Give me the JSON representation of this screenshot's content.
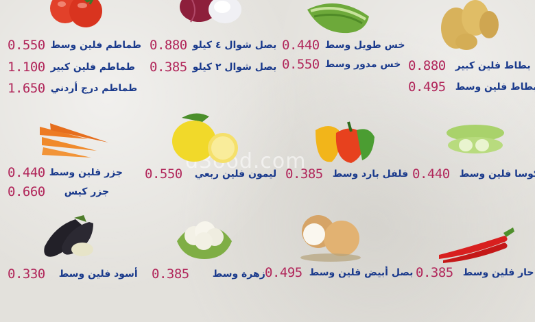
{
  "watermark": "d3ood.com",
  "items": {
    "tomato": {
      "rows": [
        {
          "name": "طماطم فلين وسط",
          "price": "0.550"
        },
        {
          "name": "طماطم فلين كبير",
          "price": "1.100"
        },
        {
          "name": "طماطم درج أردني",
          "price": "1.650"
        }
      ]
    },
    "onion": {
      "rows": [
        {
          "name": "بصل شوال ٤ كيلو",
          "price": "0.880"
        },
        {
          "name": "بصل شوال ٢ كيلو",
          "price": "0.385"
        }
      ]
    },
    "lettuce": {
      "rows": [
        {
          "name": "خس طويل وسط",
          "price": "0.440"
        },
        {
          "name": "خس مدور وسط",
          "price": "0.550"
        }
      ]
    },
    "potato": {
      "rows": [
        {
          "name": "بطاط فلين كبير",
          "price": "0.880"
        },
        {
          "name": "بطاط فلين وسط",
          "price": "0.495"
        }
      ]
    },
    "carrot": {
      "rows": [
        {
          "name": "جزر فلين وسط",
          "price": "0.440"
        },
        {
          "name": "جزر كيس",
          "price": "0.660"
        }
      ]
    },
    "lemon": {
      "rows": [
        {
          "name": "ليمون فلين ربعي",
          "price": "0.550"
        }
      ]
    },
    "pepper": {
      "rows": [
        {
          "name": "فلفل بارد وسط",
          "price": "0.385"
        }
      ]
    },
    "zucchini": {
      "rows": [
        {
          "name": "كوسا فلين وسط",
          "price": "0.440"
        }
      ]
    },
    "eggplant": {
      "rows": [
        {
          "name": "أسود فلين وسط",
          "price": "0.330"
        }
      ]
    },
    "cauliflower": {
      "rows": [
        {
          "name": "زهرة وسط",
          "price": "0.385"
        }
      ]
    },
    "white_onion": {
      "rows": [
        {
          "name": "بصل أبيض فلين وسط",
          "price": "0.495"
        }
      ]
    },
    "chili": {
      "rows": [
        {
          "name": "حار فلين وسط",
          "price": "0.385"
        }
      ]
    }
  }
}
